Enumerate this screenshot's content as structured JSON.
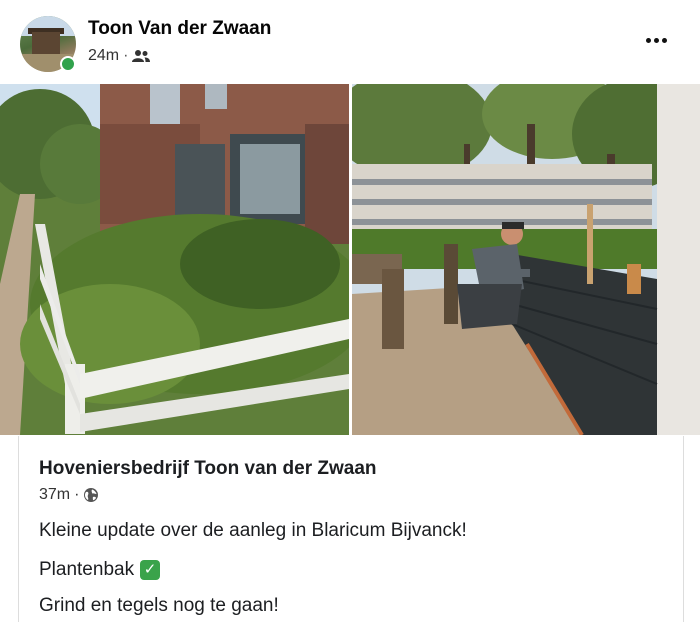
{
  "post": {
    "author": "Toon Van der Zwaan",
    "time": "24m",
    "separator": "·",
    "audience_icon": "friends-icon",
    "more_icon": "more-options-icon"
  },
  "photos": [
    {
      "description_icon": "garden-before-photo"
    },
    {
      "description_icon": "planter-work-photo"
    }
  ],
  "shared": {
    "page_name": "Hoveniersbedrijf Toon van der Zwaan",
    "time": "37m",
    "separator": "·",
    "audience_icon": "globe-icon",
    "line1": "Kleine update over de aanleg in Blaricum Bijvanck!",
    "line2": "Plantenbak",
    "line2_emoji": "✓",
    "line3": "Grind en tegels nog te gaan!"
  },
  "colors": {
    "online": "#31a24c",
    "check": "#3aa34a"
  }
}
